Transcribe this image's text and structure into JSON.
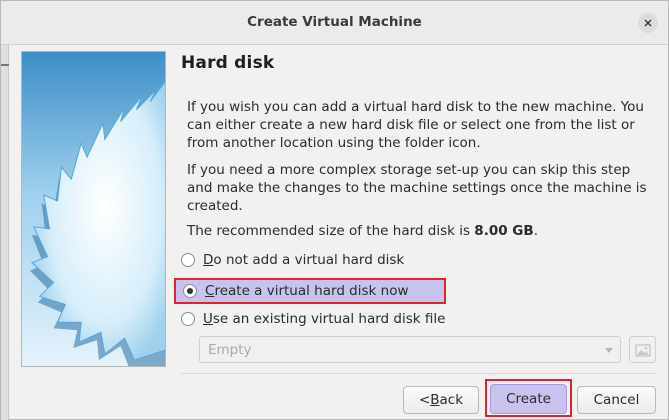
{
  "window": {
    "title": "Create Virtual Machine"
  },
  "page": {
    "heading": "Hard disk",
    "paragraph1": "If you wish you can add a virtual hard disk to the new machine. You can either create a new hard disk file or select one from the list or from another location using the folder icon.",
    "paragraph2": "If you need a more complex storage set-up you can skip this step and make the changes to the machine settings once the machine is created.",
    "recommended_prefix": "The recommended size of the hard disk is ",
    "recommended_size": "8.00 GB",
    "recommended_suffix": "."
  },
  "options": [
    {
      "mnemonic": "D",
      "rest": "o not add a virtual hard disk",
      "selected": false
    },
    {
      "mnemonic": "C",
      "rest": "reate a virtual hard disk now",
      "selected": true
    },
    {
      "mnemonic": "U",
      "rest": "se an existing virtual hard disk file",
      "selected": false
    }
  ],
  "disk_select": {
    "value": "Empty",
    "enabled": false
  },
  "buttons": {
    "back_prefix": "< ",
    "back_mnemonic": "B",
    "back_rest": "ack",
    "create": "Create",
    "cancel": "Cancel"
  },
  "icons": {
    "close": "close-icon",
    "folder": "folder-image-icon",
    "wizard_art": "starburst-illustration"
  },
  "colors": {
    "highlight_border": "#e0222e",
    "selected_fill": "#c7c2ee",
    "art_blue_dark": "#2f7fb7",
    "art_blue_light": "#bfe2f5"
  }
}
